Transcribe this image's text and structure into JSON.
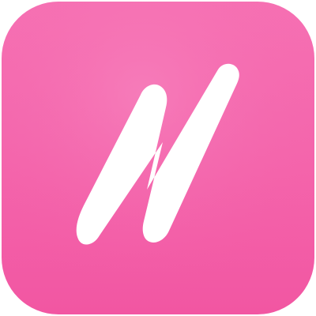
{
  "app_icon": {
    "name": "N",
    "glyph": "N",
    "colors": {
      "background_top": "#f672b4",
      "background_bottom": "#f256a2",
      "glyph": "#ffffff"
    },
    "icon_name": "letter-n-logo-icon"
  }
}
